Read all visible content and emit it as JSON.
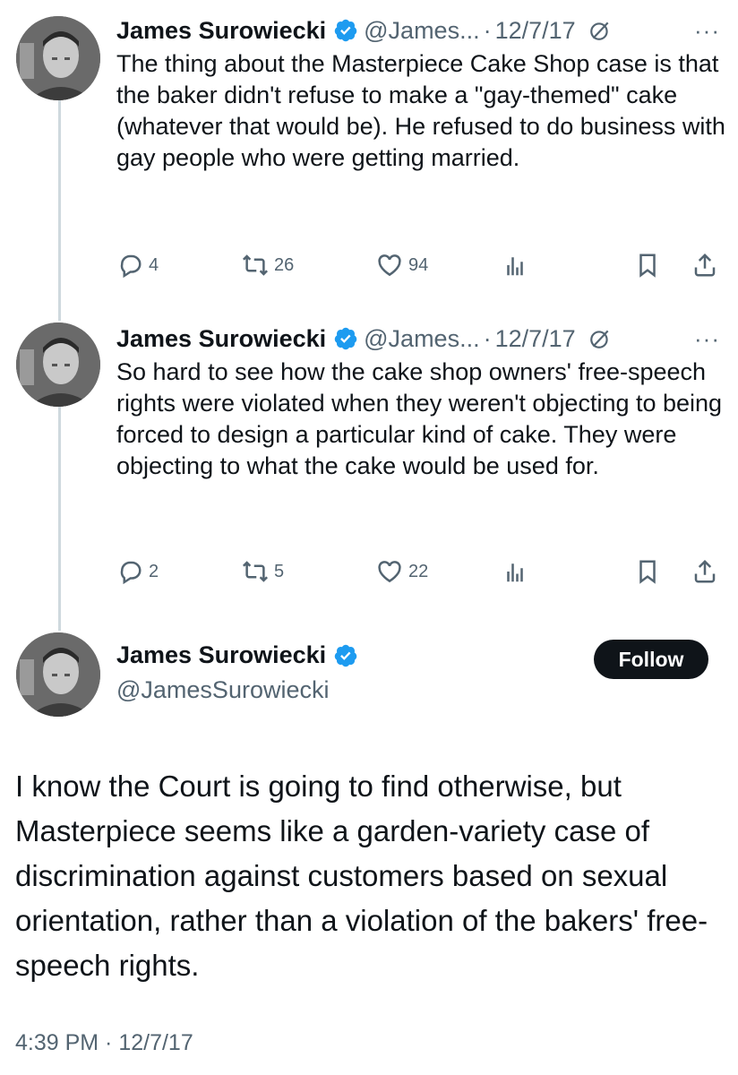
{
  "colors": {
    "text": "#0f1419",
    "secondary": "#536471",
    "verified": "#1d9bf0",
    "button": "#0f1419"
  },
  "tweets": [
    {
      "author_name": "James Surowiecki",
      "handle": "@James...",
      "separator": "·",
      "date": "12/7/17",
      "more": "···",
      "text": "The thing about the Masterpiece Cake Shop case is that the baker didn't refuse to make a \"gay-themed\" cake (whatever that would be). He refused to do business with gay people who were getting married.",
      "replies": "4",
      "reposts": "26",
      "likes": "94"
    },
    {
      "author_name": "James Surowiecki",
      "handle": "@James...",
      "separator": "·",
      "date": "12/7/17",
      "more": "···",
      "text": "So hard to see how the cake shop owners' free-speech rights were violated when they weren't objecting to being forced to design a particular kind of cake. They were objecting to what the cake would be used for.",
      "replies": "2",
      "reposts": "5",
      "likes": "22"
    }
  ],
  "main_tweet": {
    "author_name": "James Surowiecki",
    "handle": "@JamesSurowiecki",
    "follow_label": "Follow",
    "text": "I know the Court is going to find otherwise, but Masterpiece seems like a garden-variety case of discrimination against customers based on sexual orientation, rather than a violation of the bakers' free-speech rights.",
    "timestamp": "4:39 PM · 12/7/17"
  },
  "icons": [
    "reply-icon",
    "repost-icon",
    "like-icon",
    "views-icon",
    "bookmark-icon",
    "share-icon",
    "verified-badge-icon",
    "grok-icon"
  ]
}
